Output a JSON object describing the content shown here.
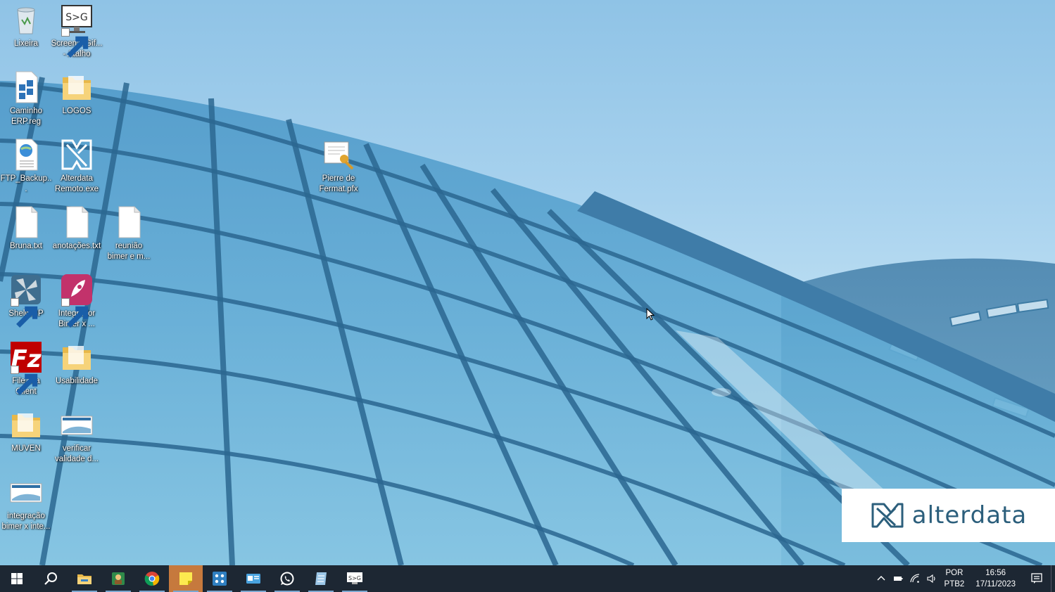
{
  "desktop_icons": [
    {
      "label": "Lixeira",
      "icon": "recycle-bin-icon",
      "shortcut": false
    },
    {
      "label": "ScreenToGif...\n- Atalho",
      "icon": "screentogif-icon",
      "shortcut": true
    },
    {
      "label": "Caminho\nERP.reg",
      "icon": "registry-file-icon",
      "shortcut": false
    },
    {
      "label": "LOGOS",
      "icon": "folder-icon",
      "shortcut": false
    },
    {
      "label": "FTP_Backup...",
      "icon": "web-document-icon",
      "shortcut": false
    },
    {
      "label": "Alterdata\nRemoto.exe",
      "icon": "alterdata-remote-icon",
      "shortcut": false
    },
    {
      "label": "Pierre de\nFermat.pfx",
      "icon": "certificate-icon",
      "shortcut": false
    },
    {
      "label": "Bruna.txt",
      "icon": "text-file-icon",
      "shortcut": false
    },
    {
      "label": "anotações.txt",
      "icon": "text-file-icon",
      "shortcut": false
    },
    {
      "label": "reunião\nbimer e m...",
      "icon": "text-file-icon",
      "shortcut": false
    },
    {
      "label": "ShellERP",
      "icon": "shellerp-icon",
      "shortcut": true
    },
    {
      "label": "Integrador\nBimer x ...",
      "icon": "rocket-app-icon",
      "shortcut": true
    },
    {
      "label": "FileZilla\nClient",
      "icon": "filezilla-icon",
      "shortcut": true
    },
    {
      "label": "Usabilidade",
      "icon": "folder-icon",
      "shortcut": false
    },
    {
      "label": "MUVEN",
      "icon": "folder-icon",
      "shortcut": false
    },
    {
      "label": "verificar\nvalidade d...",
      "icon": "image-file-icon",
      "shortcut": false
    },
    {
      "label": "integração\nbimer x inte...",
      "icon": "image-file-icon",
      "shortcut": false
    }
  ],
  "brand": {
    "text": "alterdata",
    "color": "#2c5f7c"
  },
  "taskbar": {
    "items": [
      {
        "name": "start-button",
        "icon": "windows-logo-icon"
      },
      {
        "name": "search-button",
        "icon": "search-icon"
      },
      {
        "name": "file-explorer-button",
        "icon": "file-explorer-icon"
      },
      {
        "name": "app-button-green",
        "icon": "green-app-icon"
      },
      {
        "name": "chrome-button",
        "icon": "chrome-icon"
      },
      {
        "name": "sticky-notes-button",
        "icon": "sticky-notes-icon"
      },
      {
        "name": "app-button-blue",
        "icon": "blue-grid-app-icon"
      },
      {
        "name": "app-button-card",
        "icon": "id-card-app-icon"
      },
      {
        "name": "whatsapp-button",
        "icon": "whatsapp-icon"
      },
      {
        "name": "app-button-notes",
        "icon": "notepad-app-icon"
      },
      {
        "name": "screentogif-button",
        "icon": "screentogif-icon"
      }
    ],
    "tray": {
      "language_top": "POR",
      "language_bottom": "PTB2",
      "time": "16:56",
      "date": "17/11/2023"
    },
    "colors": {
      "background": "#1d2733",
      "active": "#c6793d"
    }
  }
}
